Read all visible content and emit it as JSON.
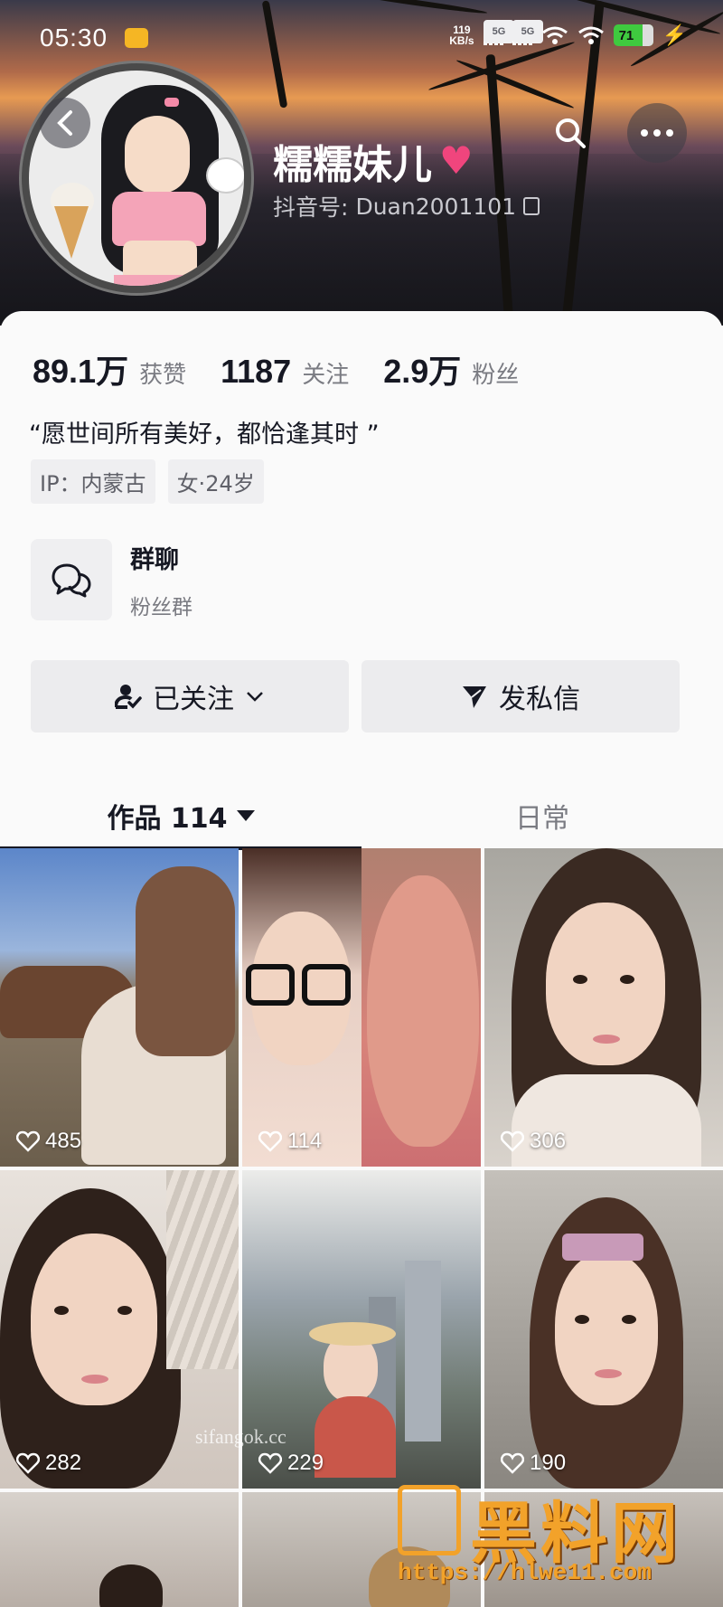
{
  "status_bar": {
    "time": "05:30",
    "net_speed_value": "119",
    "net_speed_unit": "KB/s",
    "signal1_label": "5G",
    "signal2_label": "5G",
    "battery": "71"
  },
  "profile": {
    "nickname": "糯糯妹儿",
    "douyin_id_label": "抖音号: ",
    "douyin_id": "Duan2001101"
  },
  "stats": [
    {
      "value": "89.1万",
      "label": "获赞"
    },
    {
      "value": "1187",
      "label": "关注"
    },
    {
      "value": "2.9万",
      "label": "粉丝"
    }
  ],
  "bio": "“愿世间所有美好，都恰逢其时 ”",
  "tags": [
    "IP：内蒙古",
    "女·24岁"
  ],
  "group": {
    "title": "群聊",
    "subtitle": "粉丝群"
  },
  "actions": {
    "follow": "已关注",
    "message": "发私信"
  },
  "tabs": {
    "works": "作品 114",
    "daily": "日常"
  },
  "videos": [
    {
      "likes": "485"
    },
    {
      "likes": "114"
    },
    {
      "likes": "306"
    },
    {
      "likes": "282"
    },
    {
      "likes": "229"
    },
    {
      "likes": "190"
    }
  ],
  "watermark": {
    "title": "黑料网",
    "url": "https://hlwe11.com",
    "overlay": "sifangok.cc"
  },
  "colors": {
    "accent_heart": "#f0457d",
    "battery": "#3fca3f",
    "watermark": "#f2a22a"
  }
}
